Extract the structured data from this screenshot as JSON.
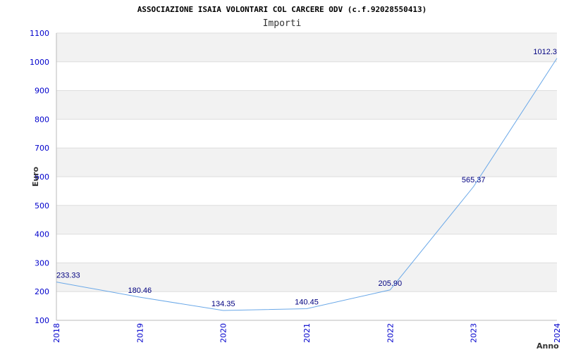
{
  "chart_data": {
    "type": "line",
    "title": "ASSOCIAZIONE ISAIA VOLONTARI COL CARCERE ODV (c.f.92028550413)",
    "subtitle": "Importi",
    "xlabel": "Anno",
    "ylabel": "Euro",
    "categories": [
      "2018",
      "2019",
      "2020",
      "2021",
      "2022",
      "2023",
      "2024"
    ],
    "values": [
      233.33,
      180.46,
      134.35,
      140.45,
      205.9,
      565.37,
      1012.3
    ],
    "value_labels": [
      "233.33",
      "180.46",
      "134.35",
      "140.45",
      "205.90",
      "565.37",
      "1012.3"
    ],
    "ylim": [
      100,
      1100
    ],
    "yticks": [
      100,
      200,
      300,
      400,
      500,
      600,
      700,
      800,
      900,
      1000,
      1100
    ],
    "grid": true,
    "band_colors": [
      "#ffffff",
      "#f2f2f2"
    ],
    "line_color": "#6aa8e8",
    "tick_color": "#0000cc",
    "label_color": "#000080"
  }
}
